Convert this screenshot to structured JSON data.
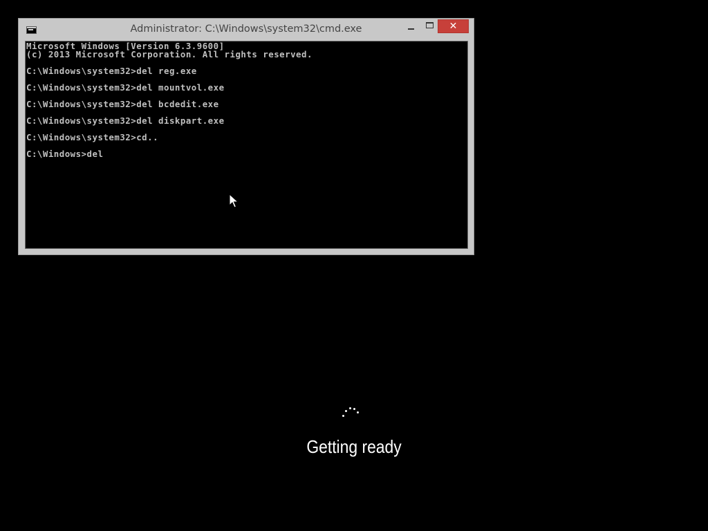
{
  "window": {
    "title": "Administrator: C:\\Windows\\system32\\cmd.exe",
    "close_glyph": "✕",
    "icons": {
      "app": "cmd-icon",
      "minimize": "minimize-icon",
      "maximize": "maximize-icon",
      "close": "close-icon"
    },
    "close_color": "#c7403a"
  },
  "console": {
    "lines": [
      "Microsoft Windows [Version 6.3.9600]",
      "(c) 2013 Microsoft Corporation. All rights reserved.",
      "",
      "C:\\Windows\\system32>del reg.exe",
      "",
      "C:\\Windows\\system32>del mountvol.exe",
      "",
      "C:\\Windows\\system32>del bcdedit.exe",
      "",
      "C:\\Windows\\system32>del diskpart.exe",
      "",
      "C:\\Windows\\system32>cd..",
      "",
      "C:\\Windows>del"
    ]
  },
  "status": {
    "text": "Getting ready",
    "icon": "loading-spinner-icon"
  }
}
